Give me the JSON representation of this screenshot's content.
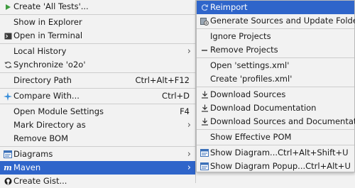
{
  "left_menu": {
    "items": [
      {
        "label": "Create 'All Tests'...",
        "icon": "run-icon",
        "shortcut": "",
        "submenu": false
      },
      {
        "sep": true
      },
      {
        "label": "Show in Explorer",
        "icon": "",
        "shortcut": "",
        "submenu": false
      },
      {
        "label": "Open in Terminal",
        "icon": "terminal-icon",
        "shortcut": "",
        "submenu": false
      },
      {
        "sep": true
      },
      {
        "label": "Local History",
        "icon": "",
        "shortcut": "",
        "submenu": true
      },
      {
        "label": "Synchronize 'o2o'",
        "icon": "sync-icon",
        "shortcut": "",
        "submenu": false
      },
      {
        "sep": true
      },
      {
        "label": "Directory Path",
        "icon": "",
        "shortcut": "Ctrl+Alt+F12",
        "submenu": false
      },
      {
        "sep": true
      },
      {
        "label": "Compare With...",
        "icon": "compare-icon",
        "shortcut": "Ctrl+D",
        "submenu": false
      },
      {
        "sep": true
      },
      {
        "label": "Open Module Settings",
        "icon": "",
        "shortcut": "F4",
        "submenu": false
      },
      {
        "label": "Mark Directory as",
        "icon": "",
        "shortcut": "",
        "submenu": true
      },
      {
        "label": "Remove BOM",
        "icon": "",
        "shortcut": "",
        "submenu": false
      },
      {
        "sep": true
      },
      {
        "label": "Diagrams",
        "icon": "diagram-icon",
        "shortcut": "",
        "submenu": true
      },
      {
        "label": "Maven",
        "icon": "maven-icon",
        "shortcut": "",
        "submenu": true,
        "selected": true
      },
      {
        "label": "Create Gist...",
        "icon": "github-icon",
        "shortcut": "",
        "submenu": false
      }
    ]
  },
  "right_menu": {
    "items": [
      {
        "label": "Reimport",
        "icon": "reimport-icon",
        "shortcut": "",
        "selected": true
      },
      {
        "label": "Generate Sources and Update Folders",
        "icon": "generate-icon",
        "shortcut": ""
      },
      {
        "sep": true
      },
      {
        "label": "Ignore Projects",
        "icon": "",
        "shortcut": ""
      },
      {
        "label": "Remove Projects",
        "icon": "minus-icon",
        "shortcut": ""
      },
      {
        "sep": true
      },
      {
        "label": "Open 'settings.xml'",
        "icon": "",
        "shortcut": ""
      },
      {
        "label": "Create 'profiles.xml'",
        "icon": "",
        "shortcut": ""
      },
      {
        "sep": true
      },
      {
        "label": "Download Sources",
        "icon": "download-icon",
        "shortcut": ""
      },
      {
        "label": "Download Documentation",
        "icon": "download-icon",
        "shortcut": ""
      },
      {
        "label": "Download Sources and Documentation",
        "icon": "download-icon",
        "shortcut": ""
      },
      {
        "sep": true
      },
      {
        "label": "Show Effective POM",
        "icon": "",
        "shortcut": ""
      },
      {
        "sep": true
      },
      {
        "label": "Show Diagram...",
        "icon": "diagram-icon",
        "shortcut": "Ctrl+Alt+Shift+U"
      },
      {
        "label": "Show Diagram Popup...",
        "icon": "diagram-icon",
        "shortcut": "Ctrl+Alt+U"
      }
    ]
  },
  "colors": {
    "selection": "#2f65ca",
    "menu_bg": "#f2f2f2",
    "run_icon": "#3e9b3e",
    "compare_icon": "#3b8fd9",
    "maven_icon": "#2f65ca"
  }
}
